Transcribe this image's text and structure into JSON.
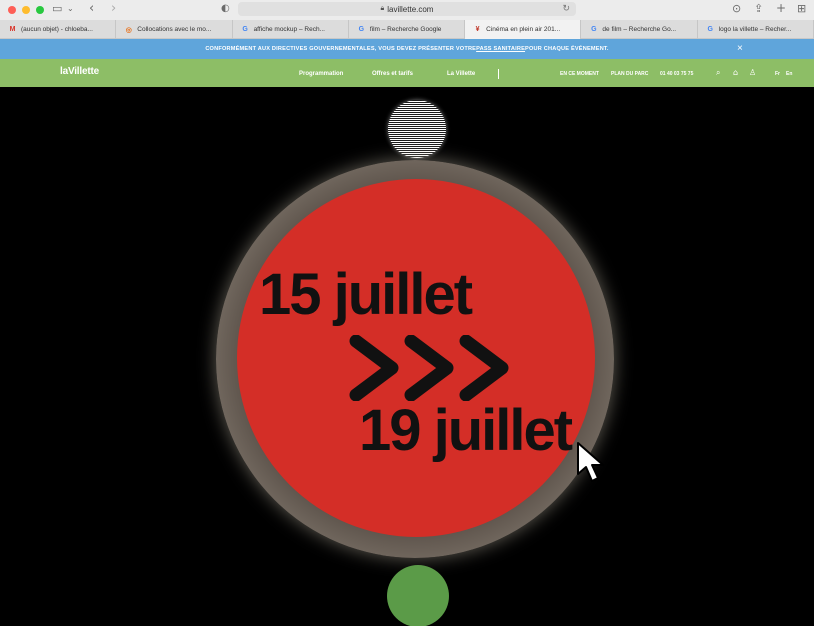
{
  "browser": {
    "url": "lavillette.com",
    "tabs": [
      {
        "favicon": "gmail-icon",
        "label": "(aucun objet) - chloeba...",
        "active": false
      },
      {
        "favicon": "colocation-icon",
        "label": "Collocations avec le mo...",
        "active": false
      },
      {
        "favicon": "google-icon",
        "label": "affiche mockup – Rech...",
        "active": false
      },
      {
        "favicon": "google-icon",
        "label": "film – Recherche Google",
        "active": false
      },
      {
        "favicon": "lavillette-icon",
        "label": "Cinéma en plein air 201...",
        "active": true
      },
      {
        "favicon": "google-icon",
        "label": "de film – Recherche Go...",
        "active": false
      },
      {
        "favicon": "google-icon",
        "label": "logo la villette – Recher...",
        "active": false
      }
    ]
  },
  "notice": {
    "text_before": "CONFORMÉMENT AUX DIRECTIVES GOUVERNEMENTALES, VOUS DEVEZ PRÉSENTER VOTRE ",
    "link": "PASS SANITAIRE",
    "text_after": " POUR CHAQUE ÉVÉNEMENT.",
    "close": "×"
  },
  "nav": {
    "logo": "laVillette",
    "links": [
      "Programmation",
      "Offres et tarifs",
      "La Villette"
    ],
    "utility": [
      "EN CE MOMENT",
      "PLAN DU PARC",
      "01 40 03 75 75"
    ],
    "lang_fr": "Fr",
    "lang_en": "En"
  },
  "poster": {
    "date_start": "15 juillet",
    "date_end": "19 juillet"
  },
  "colors": {
    "notice_bg": "#5fa5db",
    "nav_bg": "#8dbe66",
    "red_circle": "#d42e27",
    "green_circle": "#5b9b48"
  }
}
